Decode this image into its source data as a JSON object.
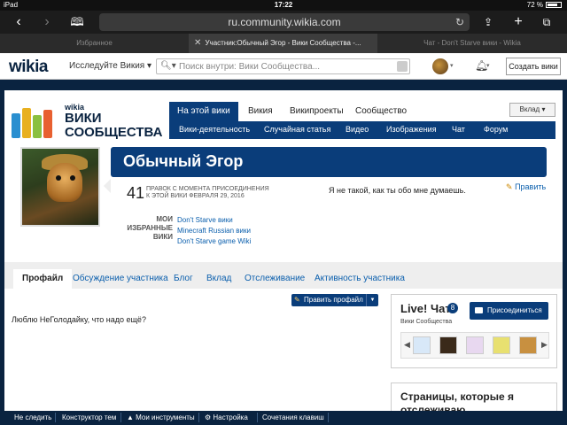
{
  "status_bar": {
    "device": "iPad",
    "time": "17:22",
    "battery": "72 %"
  },
  "browser": {
    "url": "ru.community.wikia.com",
    "tabs": [
      {
        "label": "Избранное",
        "active": false
      },
      {
        "label": "Участник:Обычный Эгор - Вики Сообщества -...",
        "active": true
      },
      {
        "label": "Чат - Don't Starve вики - Wikia",
        "active": false
      }
    ]
  },
  "global_nav": {
    "logo": "wikia",
    "explore_label": "Исследуйте Викия",
    "search_placeholder": "Поиск внутри: Вики Сообщества...",
    "create_wiki_label": "Создать вики"
  },
  "wiki": {
    "logo_brand": "wikia",
    "logo_line1": "ВИКИ",
    "logo_line2": "СООБЩЕСТВА",
    "tabs": [
      {
        "label": "На этой вики",
        "active": true
      },
      {
        "label": "Викия",
        "active": false
      },
      {
        "label": "Википроекты",
        "active": false
      },
      {
        "label": "Сообщество",
        "active": false
      }
    ],
    "subnav": [
      "Вики-деятельность",
      "Случайная статья",
      "Видео",
      "Изображения",
      "Чат",
      "Форум"
    ],
    "login_label": "Вклад"
  },
  "profile": {
    "name": "Обычный Эгор",
    "edit_count": "41",
    "edit_desc_line1": "ПРАВОК С МОМЕНТА ПРИСОЕДИНЕНИЯ",
    "edit_desc_line2": "К ЭТОЙ ВИКИ ФЕВРАЛЯ 29, 2016",
    "bio": "Я не такой, как ты обо мне думаешь.",
    "edit_link": "Править",
    "fav_label_line1": "МОИ",
    "fav_label_line2": "ИЗБРАННЫЕ",
    "fav_label_line3": "ВИКИ",
    "favorite_wikis": [
      "Don't Starve вики",
      "Minecraft Russian вики",
      "Don't Starve game Wiki"
    ]
  },
  "user_tabs": [
    {
      "label": "Профайл",
      "active": true
    },
    {
      "label": "Обсуждение участника",
      "active": false
    },
    {
      "label": "Блог",
      "active": false
    },
    {
      "label": "Вклад",
      "active": false
    },
    {
      "label": "Отслеживание",
      "active": false
    },
    {
      "label": "Активность участника",
      "active": false
    }
  ],
  "edit_profile_label": "Править профайл",
  "about_text": "Люблю НеГолодайку, что надо ещё?",
  "chat": {
    "title": "Live! Чат",
    "count": "8",
    "wiki_name": "Вики Сообщества",
    "join_label": "Присоединиться",
    "user_colors": [
      "#d8e8f8",
      "#3a2a1a",
      "#e8d8f0",
      "#e8e070",
      "#c89040"
    ]
  },
  "rail_pages_title": "Страницы, которые я отслеживаю",
  "bottom_toolbar": [
    "Не следить",
    "Конструктор тем",
    "Мои инструменты",
    "Настройка",
    "Сочетания клавиш"
  ]
}
